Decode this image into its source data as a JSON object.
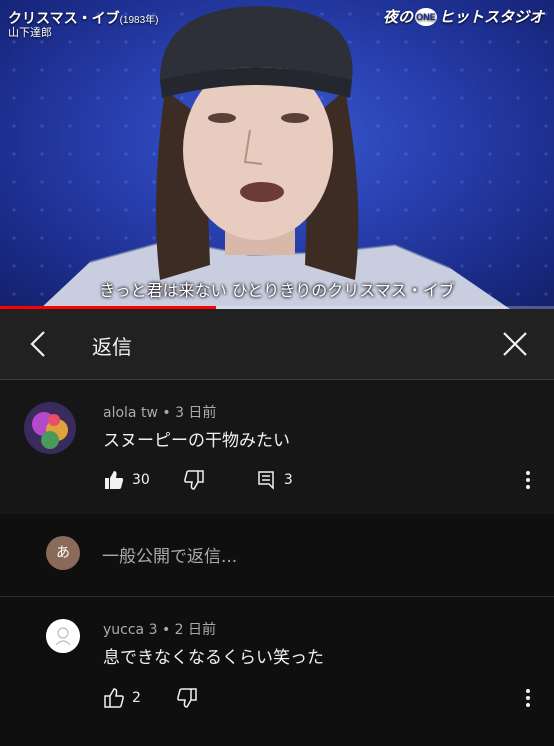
{
  "video": {
    "song_title": "クリスマス・イブ",
    "song_year": "(1983年)",
    "artist": "山下達郎",
    "show_logo_prefix": "夜の",
    "show_logo_badge": "ONE",
    "show_logo_suffix": "ヒットスタジオ",
    "subtitle": "きっと君は来ない ひとりきりのクリスマス・イブ",
    "progress_fraction": 0.39
  },
  "header": {
    "back_icon": "chevron-left-icon",
    "title": "返信",
    "close_icon": "close-icon"
  },
  "main_comment": {
    "author": "alola tw",
    "time": "3 日前",
    "text": "スヌーピーの干物みたい",
    "like_count": "30",
    "reply_count": "3"
  },
  "reply_box": {
    "avatar_letter": "あ",
    "placeholder": "一般公開で返信..."
  },
  "reply_comment": {
    "author": "yucca 3",
    "time": "2 日前",
    "text": "息できなくなるくらい笑った",
    "like_count": "2"
  },
  "colors": {
    "background": "#0f0f0f",
    "header_bg": "#212121",
    "comment_bg": "#161616",
    "progress": "#ff0000",
    "meta_text": "#aaaaaa"
  }
}
